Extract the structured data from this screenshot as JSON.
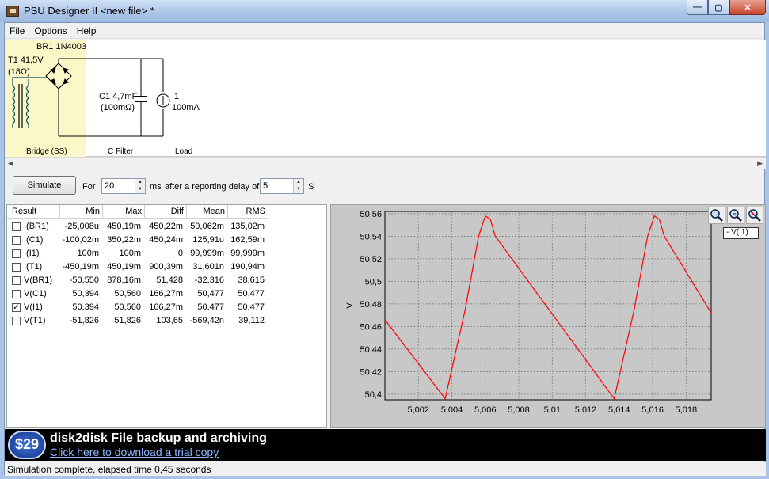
{
  "window": {
    "title": "PSU Designer II  <new file> *"
  },
  "menu": [
    "File",
    "Options",
    "Help"
  ],
  "schematic": {
    "bridge_name": "BR1 1N4003",
    "transformer_label": "T1 41,5V",
    "transformer_res": "(18Ω)",
    "cap_label": "C1 4,7mF",
    "cap_res": "(100mΩ)",
    "load_label": "I1",
    "load_value": "100mA",
    "section_bridge": "Bridge (SS)",
    "section_filter": "C Filter",
    "section_load": "Load"
  },
  "controls": {
    "simulate_label": "Simulate",
    "for_label": "For",
    "for_value": "20",
    "ms_label": "ms",
    "after_label": "after a reporting delay of",
    "delay_value": "5",
    "s_label": "S"
  },
  "table": {
    "headers": [
      "Result",
      "Min",
      "Max",
      "Diff",
      "Mean",
      "RMS"
    ],
    "rows": [
      {
        "name": "I(BR1)",
        "checked": false,
        "min": "-25,008u",
        "max": "450,19m",
        "diff": "450,22m",
        "mean": "50,062m",
        "rms": "135,02m"
      },
      {
        "name": "I(C1)",
        "checked": false,
        "min": "-100,02m",
        "max": "350,22m",
        "diff": "450,24m",
        "mean": "125,91u",
        "rms": "162,59m"
      },
      {
        "name": "I(I1)",
        "checked": false,
        "min": "100m",
        "max": "100m",
        "diff": "0",
        "mean": "99,999m",
        "rms": "99,999m"
      },
      {
        "name": "I(T1)",
        "checked": false,
        "min": "-450,19m",
        "max": "450,19m",
        "diff": "900,39m",
        "mean": "31,601n",
        "rms": "190,94m"
      },
      {
        "name": "V(BR1)",
        "checked": false,
        "min": "-50,550",
        "max": "878,16m",
        "diff": "51,428",
        "mean": "-32,316",
        "rms": "38,615"
      },
      {
        "name": "V(C1)",
        "checked": false,
        "min": "50,394",
        "max": "50,560",
        "diff": "166,27m",
        "mean": "50,477",
        "rms": "50,477"
      },
      {
        "name": "V(I1)",
        "checked": true,
        "min": "50,394",
        "max": "50,560",
        "diff": "166,27m",
        "mean": "50,477",
        "rms": "50,477"
      },
      {
        "name": "V(T1)",
        "checked": false,
        "min": "-51,826",
        "max": "51,826",
        "diff": "103,65",
        "mean": "-569,42n",
        "rms": "39,112"
      }
    ]
  },
  "legend_tip": "V(I1)",
  "chart_data": {
    "type": "line",
    "xlim": [
      5.0,
      5.0195
    ],
    "ylim": [
      50.395,
      50.562
    ],
    "xticks": [
      5.002,
      5.004,
      5.006,
      5.008,
      5.01,
      5.012,
      5.014,
      5.016,
      5.018
    ],
    "xtick_labels": [
      "5,002",
      "5,004",
      "5,006",
      "5,008",
      "5,01",
      "5,012",
      "5,014",
      "5,016",
      "5,018"
    ],
    "yticks": [
      50.4,
      50.42,
      50.44,
      50.46,
      50.48,
      50.5,
      50.52,
      50.54,
      50.56
    ],
    "ytick_labels": [
      "50,4",
      "50,42",
      "50,44",
      "50,46",
      "50,48",
      "50,5",
      "50,52",
      "50,54",
      "50,56"
    ],
    "ylabel": "V",
    "xlabel": "",
    "grid": true,
    "color": "#ff0000",
    "series": [
      {
        "name": "V(I1)",
        "x": [
          5.0,
          5.0036,
          5.0048,
          5.0056,
          5.006,
          5.0063,
          5.0066,
          5.0137,
          5.0149,
          5.0157,
          5.0161,
          5.0164,
          5.0167,
          5.0195
        ],
        "y": [
          50.466,
          50.396,
          50.475,
          50.54,
          50.558,
          50.555,
          50.54,
          50.396,
          50.475,
          50.54,
          50.558,
          50.555,
          50.54,
          50.472
        ]
      }
    ]
  },
  "banner": {
    "price": "$29",
    "title": "disk2disk File backup and archiving",
    "link": "Click here to download a trial copy"
  },
  "status": "Simulation complete, elapsed time 0,45 seconds"
}
